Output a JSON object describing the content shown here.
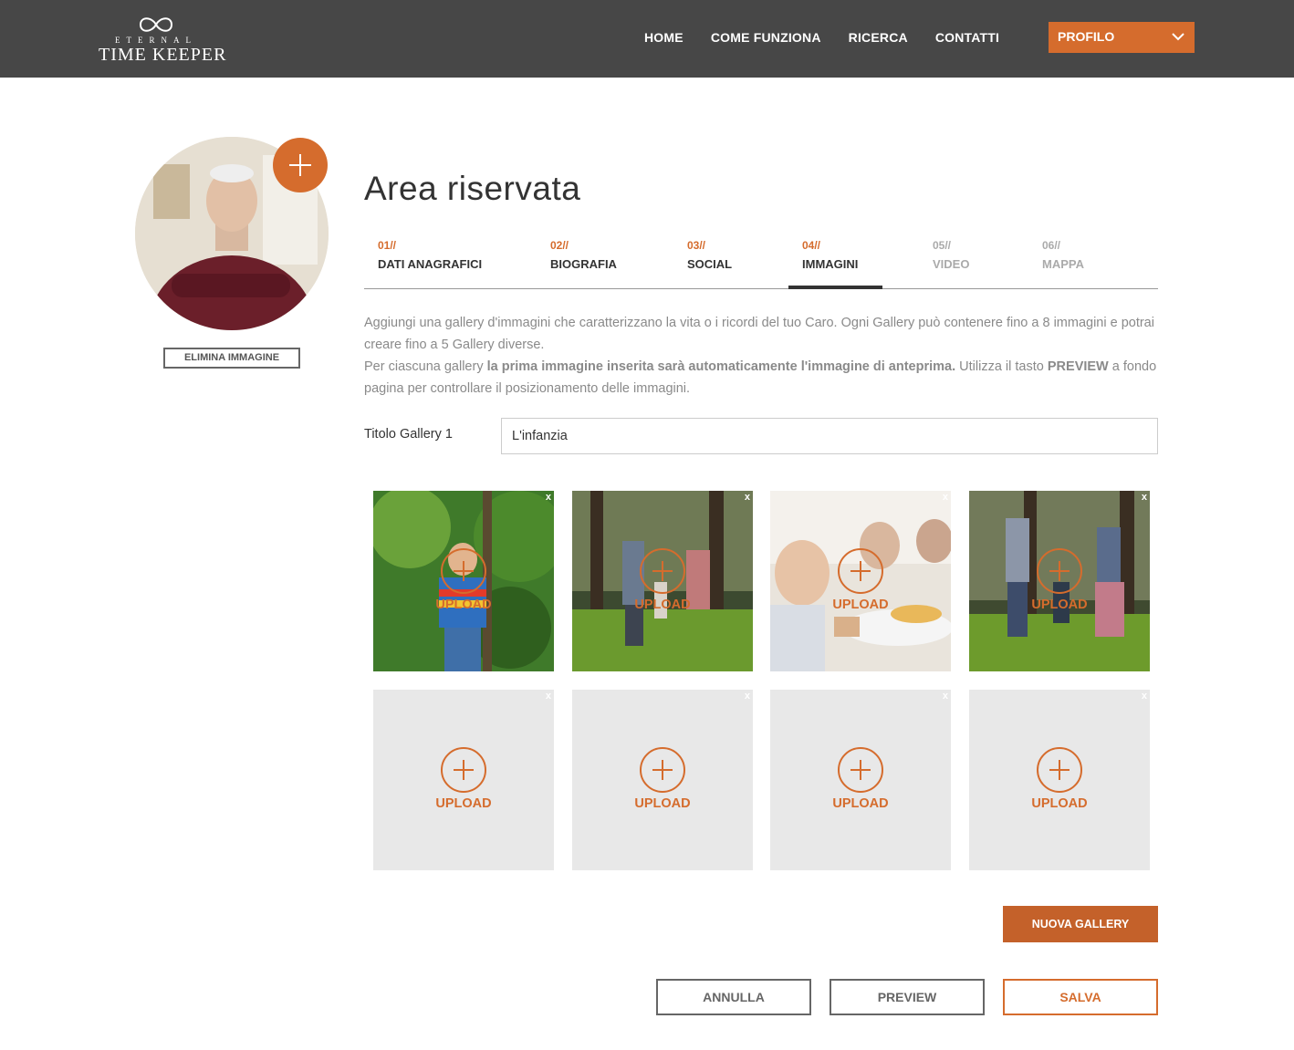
{
  "brand": {
    "logo_small": "ETERNAL",
    "logo_big": "TIME KEEPER",
    "accent_color": "#d56c2d",
    "header_bg": "#474747"
  },
  "nav": {
    "items": [
      "HOME",
      "COME FUNZIONA",
      "RICERCA",
      "CONTATTI"
    ],
    "profile_label": "PROFILO"
  },
  "sidebar": {
    "delete_image_label": "ELIMINA IMMAGINE",
    "add_icon": "plus-icon"
  },
  "main": {
    "title": "Area riservata",
    "tabs": [
      {
        "num": "01//",
        "label": "DATI ANAGRAFICI"
      },
      {
        "num": "02//",
        "label": "BIOGRAFIA"
      },
      {
        "num": "03//",
        "label": "SOCIAL"
      },
      {
        "num": "04//",
        "label": "IMMAGINI"
      },
      {
        "num": "05//",
        "label": "VIDEO"
      },
      {
        "num": "06//",
        "label": "MAPPA"
      }
    ],
    "active_tab": "IMMAGINI",
    "description": {
      "line1": "Aggiungi una gallery d'immagini che caratterizzano la vita o i ricordi del tuo Caro. Ogni Gallery può contenere fino a 8 immagini e potrai creare fino a 5 Gallery diverse.",
      "line2_prefix": "Per ciascuna gallery ",
      "line2_bold": "la prima immagine inserita sarà automaticamente l'immagine di anteprima.",
      "line2_suffix": " Utilizza il tasto ",
      "line3_bold": "PREVIEW",
      "line3_suffix": " a fondo pagina per controllare il posizionamento delle immagini."
    },
    "gallery": {
      "title_label": "Titolo Gallery 1",
      "title_value": "L'infanzia",
      "tiles": [
        {
          "close": "x",
          "upload": "UPLOAD"
        },
        {
          "close": "x",
          "upload": "UPLOAD"
        },
        {
          "close": "x",
          "upload": "UPLOAD"
        },
        {
          "close": "x",
          "upload": "UPLOAD"
        },
        {
          "close": "x",
          "upload": "UPLOAD"
        },
        {
          "close": "x",
          "upload": "UPLOAD"
        },
        {
          "close": "x",
          "upload": "UPLOAD"
        },
        {
          "close": "x",
          "upload": "UPLOAD"
        }
      ]
    },
    "new_gallery_label": "NUOVA GALLERY",
    "actions": {
      "cancel": "ANNULLA",
      "preview": "PREVIEW",
      "save": "SALVA"
    }
  }
}
